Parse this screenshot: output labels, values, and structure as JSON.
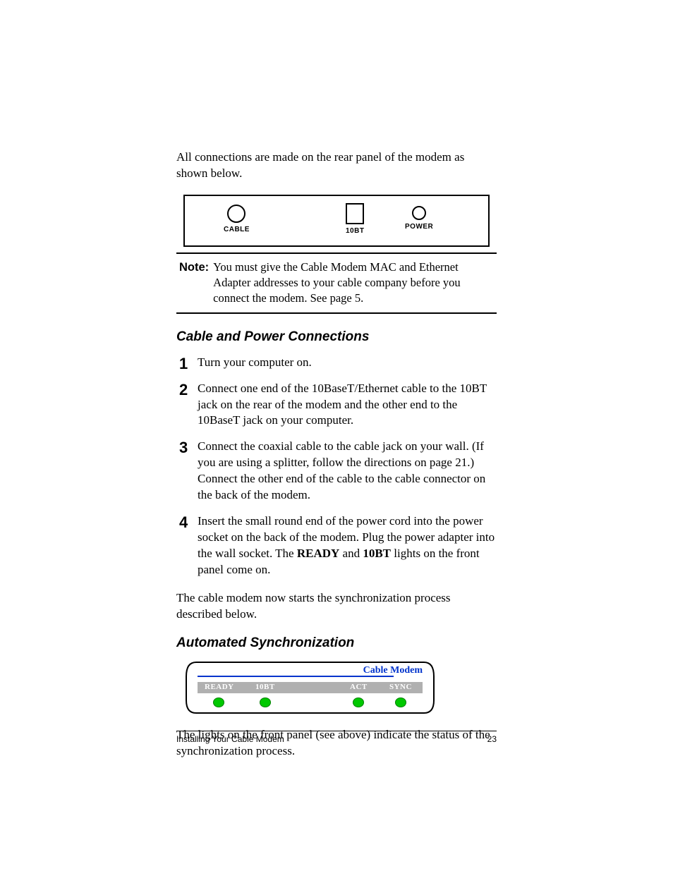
{
  "intro": "All connections are made on the rear panel of the modem as shown below.",
  "rear_panel": {
    "cable": "CABLE",
    "tenbt": "10BT",
    "power": "POWER"
  },
  "note": {
    "label": "Note:",
    "text": "You must give the Cable Modem MAC and Ethernet Adapter addresses to your cable company before you connect the modem. See page 5."
  },
  "heading1": "Cable and Power Connections",
  "steps": {
    "s1": "Turn your computer on.",
    "s2": "Connect one end of the 10BaseT/Ethernet cable to the 10BT jack on the rear of the modem and the other end to the 10BaseT jack on your computer.",
    "s3": "Connect the coaxial cable to the cable jack on your wall. (If you are using a splitter, follow the directions on page 21.) Connect the other end of the cable to the cable connector on the back of the modem.",
    "s4_a": "Insert the small round end of the power cord into the power socket on the back of the modem. Plug the power adapter into the wall socket. The ",
    "s4_b": "READY",
    "s4_c": " and ",
    "s4_d": "10BT",
    "s4_e": " lights on the front panel come on."
  },
  "after_steps": "The cable modem now starts the synchronization process described below.",
  "heading2": "Automated Synchronization",
  "front_panel": {
    "title": "Cable Modem",
    "ready": "READY",
    "tenbt": "10BT",
    "act": "ACT",
    "sync": "SYNC"
  },
  "after_panel": "The lights on the front panel (see above) indicate the status of the synchronization process.",
  "footer": {
    "title": "Installing Your Cable Modem",
    "page": "23"
  }
}
